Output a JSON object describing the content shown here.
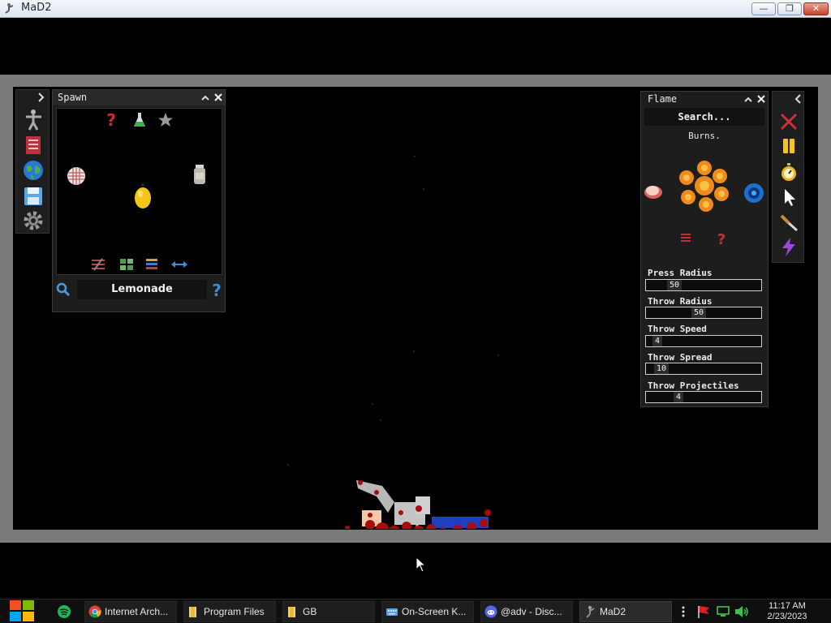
{
  "window": {
    "title": "MaD2",
    "controls": {
      "minimize": "—",
      "maximize": "❐",
      "close": "✕"
    }
  },
  "left_toolbar": {
    "collapse_icon": "chevron-right-icon",
    "tools": [
      "ragdoll-icon",
      "book-icon",
      "globe-icon",
      "save-icon",
      "settings-gear-icon"
    ]
  },
  "spawn_panel": {
    "title": "Spawn",
    "selected_item": "Lemonade",
    "grid_icons": [
      "random-question-icon",
      "potion-flask-icon",
      "favorite-star-icon",
      "crosshair-grid-icon",
      "jar-icon",
      "lemon-icon",
      "sliders-icon",
      "category-grid-icon",
      "list-icon",
      "swap-arrows-icon"
    ]
  },
  "flame_panel": {
    "title": "Flame",
    "search_placeholder": "Search...",
    "description": "Burns.",
    "fields": [
      {
        "label": "Press Radius",
        "value": "50"
      },
      {
        "label": "Throw Radius",
        "value": "50"
      },
      {
        "label": "Throw Speed",
        "value": "4"
      },
      {
        "label": "Throw Spread",
        "value": "10"
      },
      {
        "label": "Throw Projectiles",
        "value": "4"
      }
    ]
  },
  "right_toolbar": {
    "collapse_icon": "chevron-left-icon",
    "tools": [
      "clear-x-icon",
      "pause-icon",
      "stopwatch-icon",
      "cursor-icon",
      "knife-icon",
      "lightning-icon"
    ]
  },
  "taskbar": {
    "items": [
      "Internet Arch...",
      "Program Files",
      "GB",
      "On-Screen K...",
      "@adv - Disc...",
      "MaD2"
    ],
    "time": "11:17 AM",
    "date": "2/23/2023"
  }
}
